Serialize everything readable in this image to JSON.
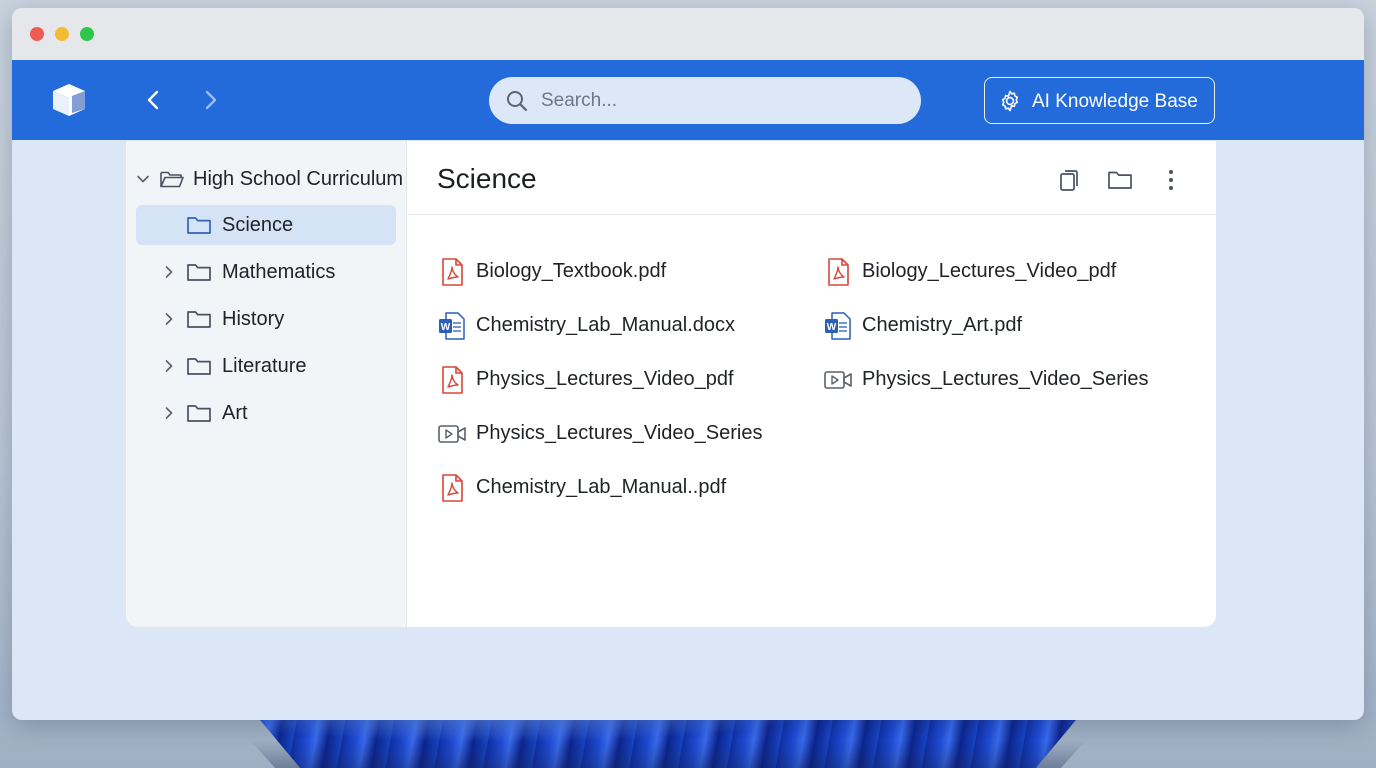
{
  "toolbar": {
    "search_placeholder": "Search...",
    "kb_label": "AI Knowledge Base"
  },
  "sidebar": {
    "root": {
      "label": "High School Curriculum",
      "expanded": true
    },
    "items": [
      {
        "label": "Science",
        "selected": true,
        "expandable": false
      },
      {
        "label": "Mathematics",
        "selected": false,
        "expandable": true
      },
      {
        "label": "History",
        "selected": false,
        "expandable": true
      },
      {
        "label": "Literature",
        "selected": false,
        "expandable": true
      },
      {
        "label": "Art",
        "selected": false,
        "expandable": true
      }
    ]
  },
  "content": {
    "title": "Science",
    "files": [
      {
        "name": "Biology_Textbook.pdf",
        "type": "pdf-icon"
      },
      {
        "name": "Biology_Lectures_Video_pdf",
        "type": "pdf-icon"
      },
      {
        "name": "Chemistry_Lab_Manual.docx",
        "type": "word-icon"
      },
      {
        "name": "Chemistry_Art.pdf",
        "type": "word-icon"
      },
      {
        "name": "Physics_Lectures_Video_pdf",
        "type": "pdf-icon"
      },
      {
        "name": "Physics_Lectures_Video_Series",
        "type": "video-icon"
      },
      {
        "name": "Physics_Lectures_Video_Series",
        "type": "video-icon"
      },
      {
        "name": "Chemistry_Lab_Manual..pdf",
        "type": "pdf-icon"
      }
    ]
  },
  "colors": {
    "accent": "#236adb",
    "selected_row": "#d4e3f6",
    "pdf": "#d9463a",
    "word": "#2b5fb8"
  }
}
